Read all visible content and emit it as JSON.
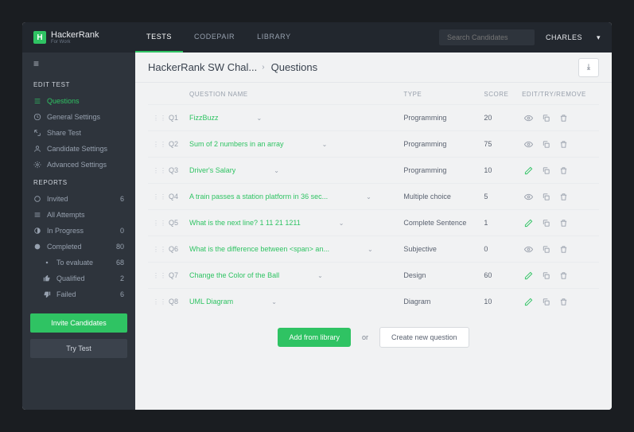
{
  "brand": {
    "name": "HackerRank",
    "sub": "For Work"
  },
  "topnav": {
    "tabs": [
      "TESTS",
      "CODEPAIR",
      "LIBRARY"
    ],
    "active": 0
  },
  "search": {
    "placeholder": "Search Candidates"
  },
  "user": {
    "name": "CHARLES"
  },
  "breadcrumb": {
    "test": "HackerRank SW Chal...",
    "page": "Questions"
  },
  "sidebar": {
    "edit_head": "EDIT TEST",
    "edit": [
      {
        "label": "Questions",
        "icon": "list",
        "active": true
      },
      {
        "label": "General Settings",
        "icon": "clock"
      },
      {
        "label": "Share Test",
        "icon": "share"
      },
      {
        "label": "Candidate Settings",
        "icon": "user"
      },
      {
        "label": "Advanced Settings",
        "icon": "gear"
      }
    ],
    "reports_head": "REPORTS",
    "reports": [
      {
        "label": "Invited",
        "icon": "circle",
        "count": "6"
      },
      {
        "label": "All Attempts",
        "icon": "rows"
      },
      {
        "label": "In Progress",
        "icon": "half",
        "count": "0"
      },
      {
        "label": "Completed",
        "icon": "full",
        "count": "80"
      }
    ],
    "completed_sub": [
      {
        "label": "To evaluate",
        "icon": "dot",
        "count": "68"
      },
      {
        "label": "Qualified",
        "icon": "thumb-up",
        "count": "2"
      },
      {
        "label": "Failed",
        "icon": "thumb-down",
        "count": "6"
      }
    ],
    "invite_btn": "Invite Candidates",
    "try_btn": "Try Test"
  },
  "table": {
    "headers": {
      "name": "QUESTION NAME",
      "type": "TYPE",
      "score": "SCORE",
      "actions": "EDIT/TRY/REMOVE"
    },
    "rows": [
      {
        "id": "Q1",
        "name": "FizzBuzz",
        "type": "Programming",
        "score": "20",
        "edit": false
      },
      {
        "id": "Q2",
        "name": "Sum of 2 numbers in an array",
        "type": "Programming",
        "score": "75",
        "edit": false
      },
      {
        "id": "Q3",
        "name": "Driver's Salary",
        "type": "Programming",
        "score": "10",
        "edit": true
      },
      {
        "id": "Q4",
        "name": "A train passes a station platform in 36 sec...",
        "type": "Multiple choice",
        "score": "5",
        "edit": false
      },
      {
        "id": "Q5",
        "name": "What is the next line? 1 11 21 1211",
        "type": "Complete Sentence",
        "score": "1",
        "edit": true
      },
      {
        "id": "Q6",
        "name": "What is the difference between <span> an...",
        "type": "Subjective",
        "score": "0",
        "edit": false
      },
      {
        "id": "Q7",
        "name": "Change the Color of the Ball",
        "type": "Design",
        "score": "60",
        "edit": true
      },
      {
        "id": "Q8",
        "name": "UML Diagram",
        "type": "Diagram",
        "score": "10",
        "edit": true
      }
    ]
  },
  "actions": {
    "add": "Add from library",
    "or": "or",
    "create": "Create new question"
  }
}
